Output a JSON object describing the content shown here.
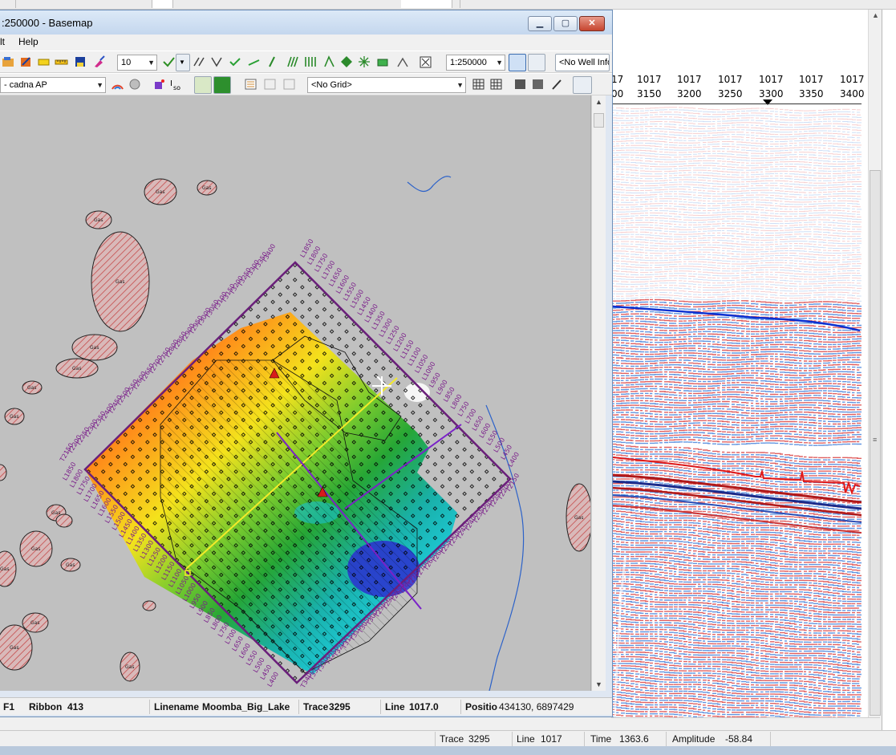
{
  "window": {
    "title": ":250000 - Basemap",
    "menu": [
      "lt",
      "Help"
    ],
    "min_glyph": "▁",
    "max_glyph": "▢",
    "close_glyph": "✕"
  },
  "toolbar1": {
    "spacing_value": "10",
    "scale_value": "1:250000",
    "well_info": "<No Well Info"
  },
  "toolbar2": {
    "layer_value": "- cadna AP",
    "grid_value": "<No Grid>"
  },
  "map": {
    "polygon_label": "Gas",
    "line_labels_upper_left": [
      "T3400",
      "T3350",
      "T3300",
      "T3250",
      "T3200",
      "T3150",
      "T3100",
      "T3050",
      "T3000",
      "T2950",
      "T2900",
      "T2850",
      "T2800",
      "T2750",
      "T2700",
      "T2650",
      "T2600",
      "T2550",
      "T2500",
      "T2450",
      "T2400",
      "T2350",
      "T2300",
      "T2250",
      "T2200",
      "T2150"
    ],
    "line_labels_lower_left": [
      "L1850",
      "L1800",
      "L1750",
      "L1700",
      "L1650",
      "L1600",
      "L1550",
      "L1500",
      "L1450",
      "L1400",
      "L1350",
      "L1300",
      "L1250",
      "L1200",
      "L1150",
      "L1100",
      "L1050",
      "L1000",
      "L950",
      "L900",
      "L850",
      "L800",
      "L750",
      "L700",
      "L650",
      "L600",
      "L550",
      "L500",
      "L450",
      "L400"
    ],
    "line_labels_upper_right": [
      "L1850",
      "L1800",
      "L1750",
      "L1700",
      "L1650",
      "L1600",
      "L1550",
      "L1500",
      "L1450",
      "L1400",
      "L1350",
      "L1300",
      "L1250",
      "L1200",
      "L1150",
      "L1100",
      "L1050",
      "L1000",
      "L950",
      "L900",
      "L850",
      "L800",
      "L750",
      "L700",
      "L650",
      "L600",
      "L550",
      "L500",
      "L450",
      "L400"
    ],
    "line_labels_lower_right": [
      "T3400",
      "T3350",
      "T3300",
      "T3250",
      "T3200",
      "T3150",
      "T3100",
      "T3050",
      "T3000",
      "T2950",
      "T2900",
      "T2850",
      "T2800",
      "T2750",
      "T2700",
      "T2650",
      "T2600",
      "T2550",
      "T2500",
      "T2450",
      "T2400",
      "T2350",
      "T2300",
      "T2250",
      "T2200",
      "T2150"
    ]
  },
  "status_basemap": {
    "f1": "F1",
    "ribbon_label": "Ribbon",
    "ribbon_value": "413",
    "linename_label": "Linename",
    "linename_value": "Moomba_Big_Lake",
    "trace_label": "Trace",
    "trace_value": "3295",
    "line_label": "Line",
    "line_value": "1017.0",
    "position_label": "Positio",
    "position_value": "434130, 6897429"
  },
  "seismic": {
    "line_header": [
      "17",
      "1017",
      "1017",
      "1017",
      "1017",
      "1017",
      "1017"
    ],
    "trace_header": [
      "00",
      "3150",
      "3200",
      "3250",
      "3300",
      "3350",
      "3400"
    ]
  },
  "status_seismic": {
    "trace_label": "Trace",
    "trace_value": "3295",
    "line_label": "Line",
    "line_value": "1017",
    "time_label": "Time",
    "time_value": "1363.6",
    "amplitude_label": "Amplitude",
    "amplitude_value": "-58.84"
  },
  "colors": {
    "titlebar": "#c4d7ee",
    "map_background": "#c0c0c0",
    "survey_outline": "#6a1f7a",
    "horizon_blue": "#0a2fd0",
    "horizon_red": "#e01818"
  }
}
